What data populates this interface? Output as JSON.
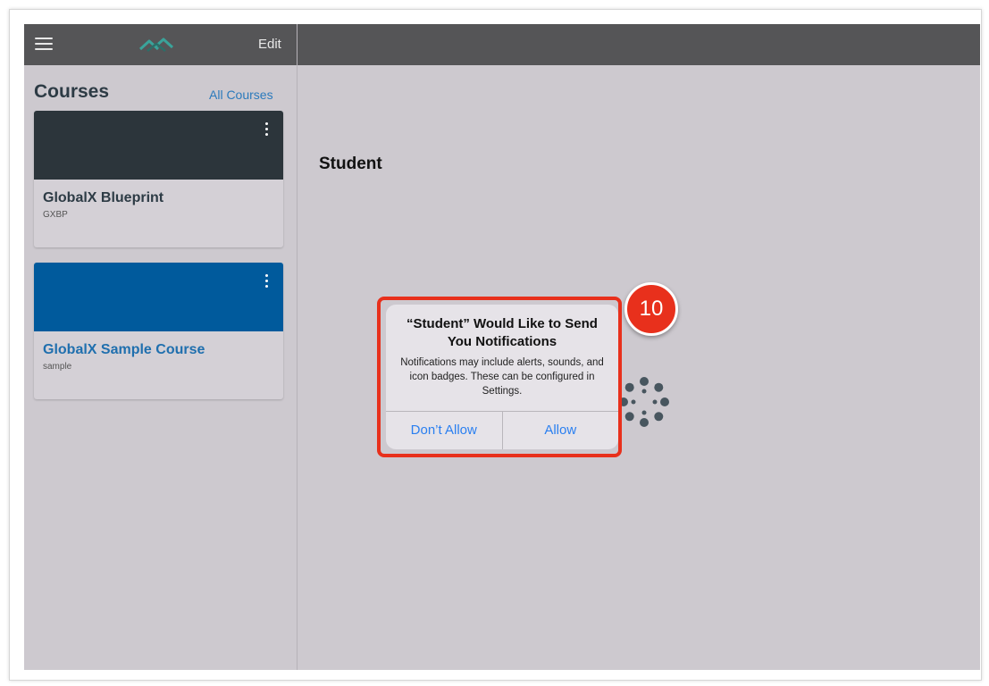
{
  "topbar": {
    "menu_icon": "hamburger-menu-icon",
    "logo_icon": "canvas-logo-icon",
    "edit_label": "Edit"
  },
  "sidebar": {
    "title": "Courses",
    "all_courses_label": "All Courses",
    "cards": [
      {
        "name": "GlobalX Blueprint",
        "code": "GXBP",
        "color": "#2c353b",
        "name_color": "#2d3b45"
      },
      {
        "name": "GlobalX Sample Course",
        "code": "sample",
        "color": "#005a9c",
        "name_color": "#1f6fae"
      }
    ]
  },
  "main": {
    "title": "Student",
    "loading_icon": "canvas-spinner-icon"
  },
  "alert": {
    "title": "“Student” Would Like to Send You Notifications",
    "message": "Notifications may include alerts, sounds, and icon badges. These can be configured in Settings.",
    "dont_allow_label": "Don’t Allow",
    "allow_label": "Allow"
  },
  "annotation": {
    "step_number": "10",
    "color": "#e8301c"
  }
}
